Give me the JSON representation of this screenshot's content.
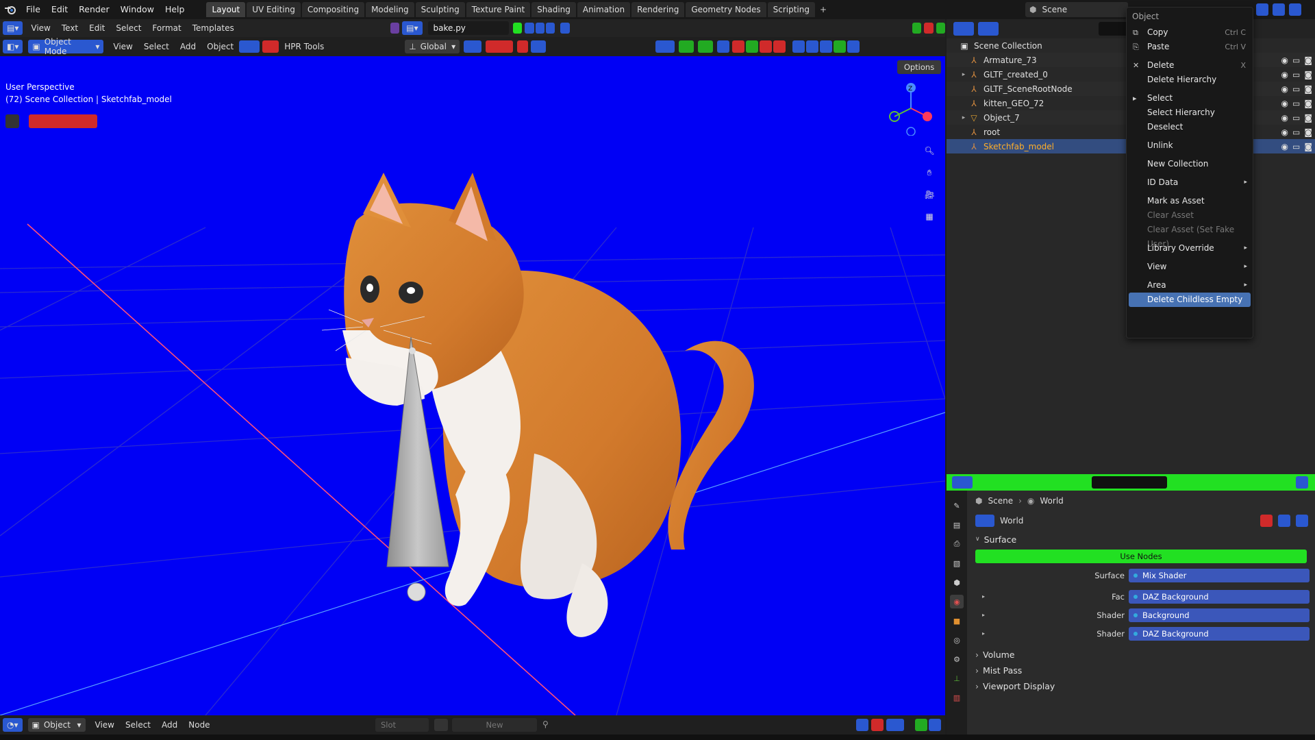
{
  "top_menu": [
    "File",
    "Edit",
    "Render",
    "Window",
    "Help"
  ],
  "workspaces": [
    "Layout",
    "UV Editing",
    "Compositing",
    "Modeling",
    "Sculpting",
    "Texture Paint",
    "Shading",
    "Animation",
    "Rendering",
    "Geometry Nodes",
    "Scripting"
  ],
  "workspace_add": "+",
  "scene_name": "Scene",
  "text_editor": {
    "menus": [
      "View",
      "Text",
      "Edit",
      "Select",
      "Format",
      "Templates"
    ],
    "file_name": "bake.py"
  },
  "viewport_header": {
    "mode": "Object Mode",
    "menus": [
      "View",
      "Select",
      "Add",
      "Object"
    ],
    "addon": "HPR Tools",
    "orientation": "Global"
  },
  "viewport": {
    "perspective": "User Perspective",
    "collection_info": "(72) Scene Collection | Sketchfab_model",
    "options": "Options",
    "gizmo_z": "Z",
    "background": "#0000f5"
  },
  "bottom_header": {
    "mode": "Object",
    "menus": [
      "View",
      "Select",
      "Add",
      "Node"
    ],
    "slot": "Slot",
    "new": "New"
  },
  "outliner": {
    "root": "Scene Collection",
    "items": [
      {
        "label": "Armature_73",
        "icon": "armature-icon",
        "expand": ""
      },
      {
        "label": "GLTF_created_0",
        "icon": "armature-icon",
        "expand": "▸"
      },
      {
        "label": "GLTF_SceneRootNode",
        "icon": "empty-icon",
        "expand": ""
      },
      {
        "label": "kitten_GEO_72",
        "icon": "empty-icon",
        "expand": ""
      },
      {
        "label": "Object_7",
        "icon": "mesh-icon",
        "expand": "▸"
      },
      {
        "label": "root",
        "icon": "empty-icon",
        "expand": ""
      },
      {
        "label": "Sketchfab_model",
        "icon": "empty-icon",
        "expand": ""
      }
    ]
  },
  "context_menu": {
    "title": "Object",
    "items": [
      {
        "label": "Copy",
        "shortcut": "Ctrl C",
        "icon": "⧉"
      },
      {
        "label": "Paste",
        "shortcut": "Ctrl V",
        "icon": "⎘"
      },
      {
        "sep": true
      },
      {
        "label": "Delete",
        "shortcut": "X",
        "icon": "✕"
      },
      {
        "label": "Delete Hierarchy"
      },
      {
        "sep": true
      },
      {
        "label": "Select",
        "icon": "▸"
      },
      {
        "label": "Select Hierarchy"
      },
      {
        "label": "Deselect"
      },
      {
        "sep": true
      },
      {
        "label": "Unlink"
      },
      {
        "sep": true
      },
      {
        "label": "New Collection"
      },
      {
        "sep": true
      },
      {
        "label": "ID Data",
        "submenu": true
      },
      {
        "sep": true
      },
      {
        "label": "Mark as Asset"
      },
      {
        "label": "Clear Asset",
        "disabled": true
      },
      {
        "label": "Clear Asset (Set Fake User)",
        "disabled": true
      },
      {
        "sep": true
      },
      {
        "label": "Library Override",
        "submenu": true
      },
      {
        "sep": true
      },
      {
        "label": "View",
        "submenu": true
      },
      {
        "sep": true
      },
      {
        "label": "Area",
        "submenu": true
      },
      {
        "label": "Delete Childless Empty",
        "highlight": true
      }
    ]
  },
  "properties": {
    "crumb_scene": "Scene",
    "crumb_world": "World",
    "world_name": "World",
    "surface_panel": "Surface",
    "use_nodes": "Use Nodes",
    "rows": [
      {
        "label": "Surface",
        "value": "Mix Shader",
        "tri": false
      },
      {
        "label": "Fac",
        "value": "DAZ Background",
        "tri": true
      },
      {
        "label": "Shader",
        "value": "Background",
        "tri": true
      },
      {
        "label": "Shader",
        "value": "DAZ Background",
        "tri": true
      }
    ],
    "collapsed_panels": [
      "Volume",
      "Mist Pass",
      "Viewport Display"
    ]
  },
  "colors": {
    "accent_green": "#22e022",
    "selection": "#4772b3",
    "viewport_blue": "#0000f5"
  }
}
